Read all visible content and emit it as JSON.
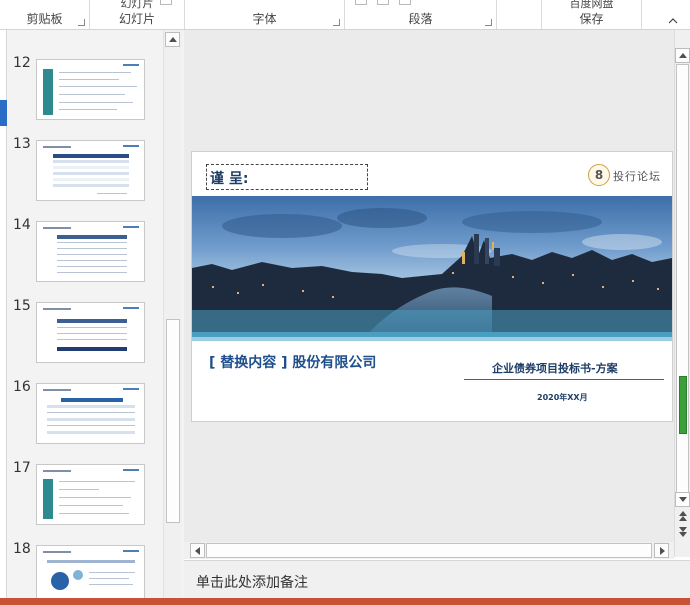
{
  "ribbon": {
    "groups": [
      {
        "label": "剪贴板",
        "top_text": ""
      },
      {
        "label": "幻灯片",
        "top_text": "幻灯片"
      },
      {
        "label": "字体",
        "top_text": ""
      },
      {
        "label": "段落",
        "top_text": ""
      },
      {
        "label": "保存",
        "top_text": "百度网盘"
      }
    ]
  },
  "thumbnails": [
    {
      "number": "12"
    },
    {
      "number": "13"
    },
    {
      "number": "14"
    },
    {
      "number": "15"
    },
    {
      "number": "16"
    },
    {
      "number": "17"
    },
    {
      "number": "18"
    }
  ],
  "slide": {
    "addressee": "谨 呈:",
    "brand_mark": "8",
    "brand_name": "投行论坛",
    "company": "[ 替换内容 ] 股份有限公司",
    "doc_title": "企业债券项目投标书-方案",
    "date": "2020年XX月"
  },
  "notes": {
    "placeholder": "单击此处添加备注"
  },
  "colors": {
    "accent_blue": "#1e4f8c",
    "teal_band": "#4a9fc0",
    "status_bar": "#c95135"
  }
}
